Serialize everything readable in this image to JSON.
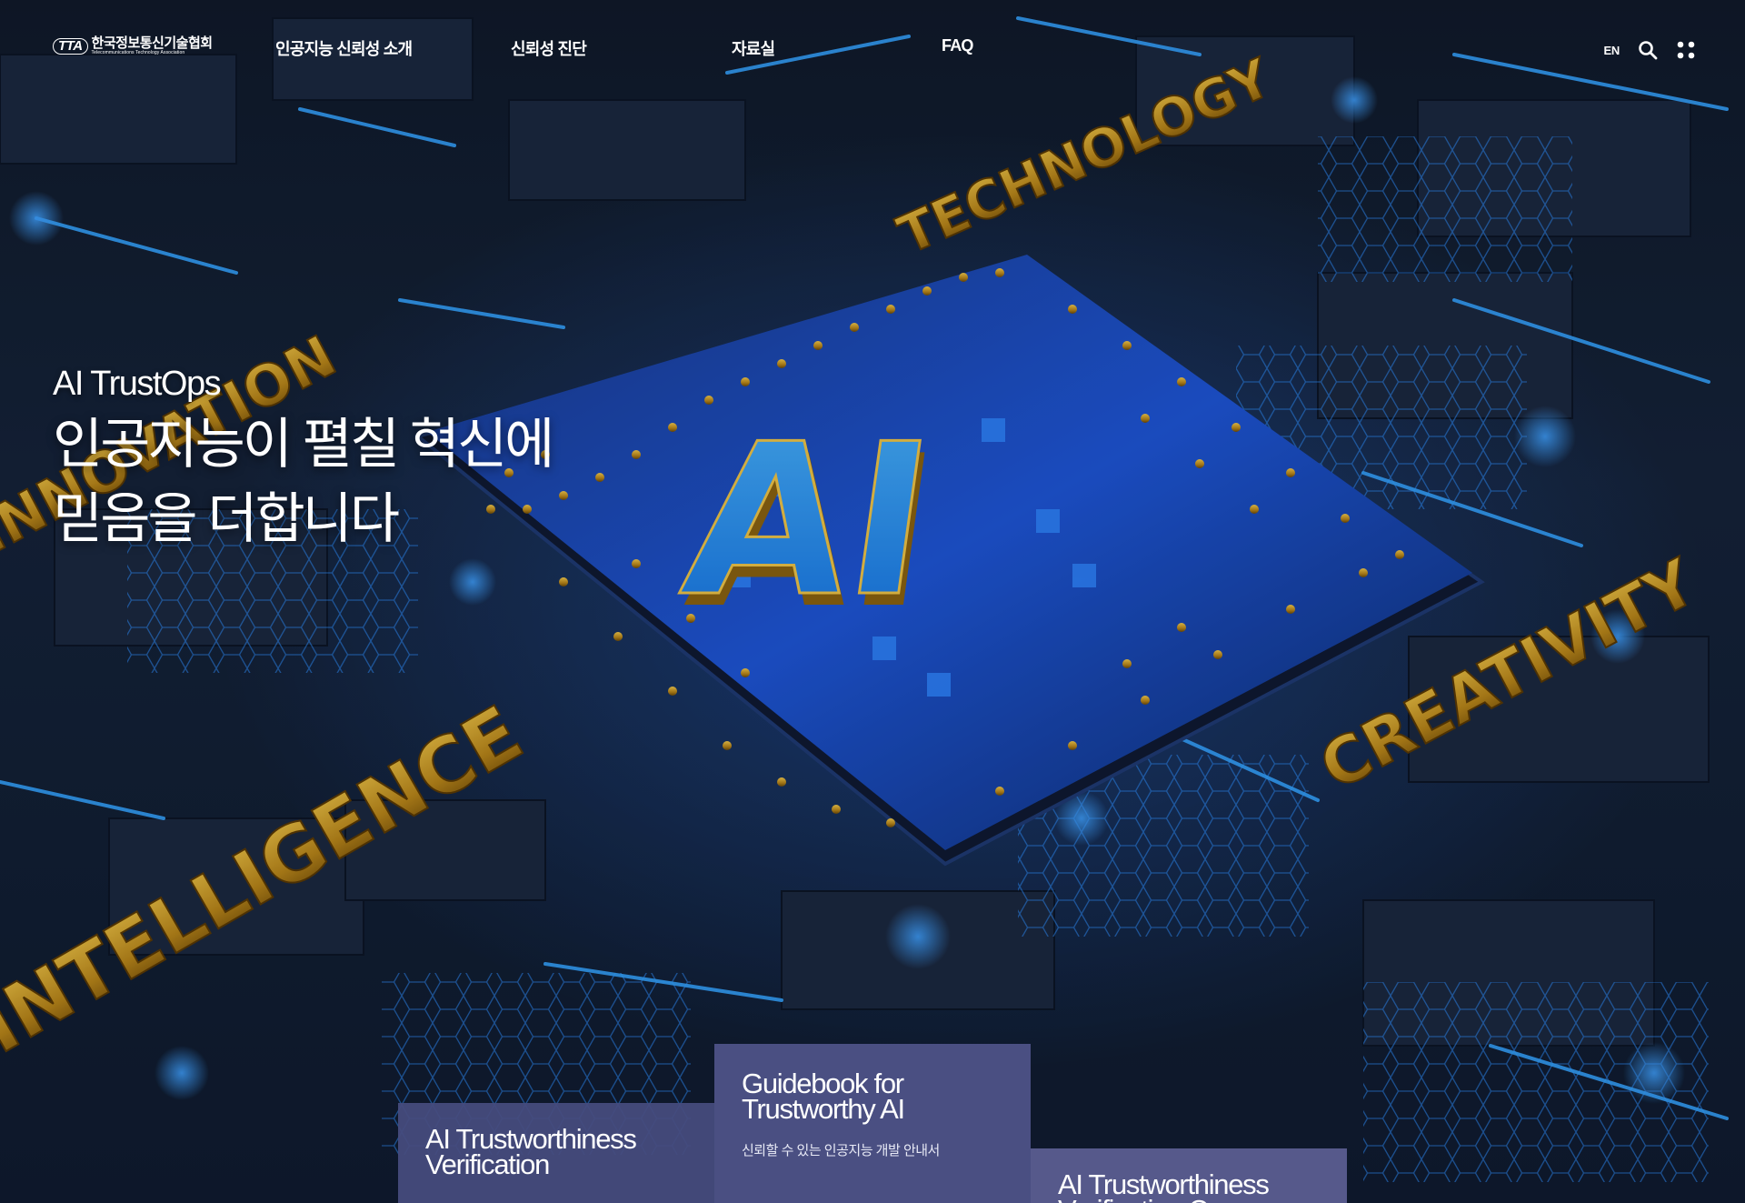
{
  "header": {
    "logo_mark": "TTA",
    "logo_name": "한국정보통신기술협회",
    "logo_subtitle": "Telecommunications Technology Association",
    "nav": [
      {
        "label": "인공지능 신뢰성 소개"
      },
      {
        "label": "신뢰성 진단"
      },
      {
        "label": "자료실"
      },
      {
        "label": "FAQ"
      }
    ],
    "lang": "EN",
    "icons": [
      "search-icon",
      "grid-menu-icon"
    ]
  },
  "hero": {
    "eyebrow": "AI TrustOps",
    "headline_line1": "인공지능이 펼칠 혁신에",
    "headline_line2": "믿음을 더합니다"
  },
  "scene_text": {
    "center": "AI",
    "top": "TECHNOLOGY",
    "left": "INNOVATION",
    "bottom_left": "INTELLIGENCE",
    "right": "CREATIVITY"
  },
  "cards": [
    {
      "title": "AI Trustworthiness Verification",
      "desc": ""
    },
    {
      "title": "Guidebook for Trustworthy AI",
      "desc": "신뢰할 수 있는 인공지능 개발 안내서"
    },
    {
      "title": "AI Trustworthiness Verification Cer",
      "desc": ""
    }
  ],
  "colors": {
    "accent_blue": "#2a8cff",
    "gold": "#c99a1e",
    "card_bg": "#4e5287"
  }
}
